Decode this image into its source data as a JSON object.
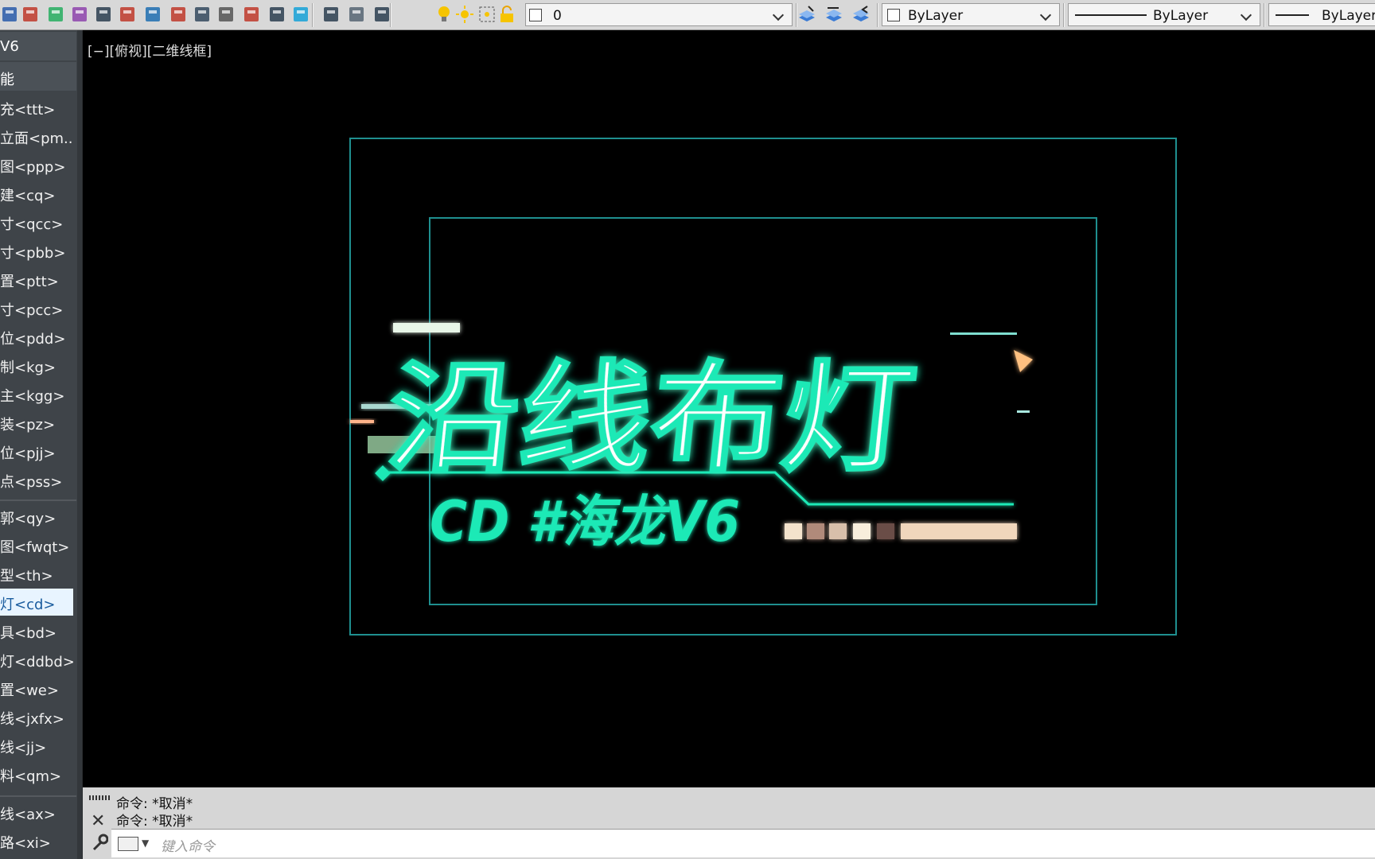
{
  "toolbar": {
    "icons": [
      "save-icon",
      "cut-icon",
      "layer-stack-icon",
      "search-replace-icon",
      "notebook-icon",
      "person-icon",
      "select-window-icon",
      "table-icon",
      "layer-tool-icon",
      "measure-icon",
      "delete-icon",
      "print-icon",
      "screen-icon",
      "lisp-edit-icon",
      "calc-icon",
      "layer-list-icon",
      "bulb-icon",
      "sun-icon",
      "freeze-icon",
      "lock-icon",
      "layer-icon-1",
      "layer-icon-2",
      "layer-icon-3"
    ],
    "layer_value": "0",
    "color_value": "ByLayer",
    "linetype_value": "ByLayer",
    "lineweight_value": "ByLayer"
  },
  "sidebar": {
    "header1": "V6",
    "header2": "能",
    "group1": [
      "充<ttt>",
      "立面<pm...",
      "图<ppp>",
      "建<cq>",
      "寸<qcc>",
      "寸<pbb>",
      "置<ptt>",
      "寸<pcc>",
      "位<pdd>",
      "制<kg>",
      "主<kgg>",
      "装<pz>",
      "位<pjj>",
      "点<pss>"
    ],
    "group2": [
      "郭<qy>",
      "图<fwqt>",
      "型<th>",
      "灯<cd>",
      "具<bd>",
      "灯<ddbd>",
      "置<we>",
      "线<jxfx>",
      "线<jj>",
      "料<qm>"
    ],
    "group3": [
      "线<ax>",
      "路<xi>"
    ],
    "active_index": 3
  },
  "viewport": {
    "label": "[−][俯视][二维线框]",
    "title_art": {
      "main": "沿线布灯",
      "sub": "CD #海龙V6",
      "glow_color": "#1de9b6",
      "frame_color": "#1f8f8f"
    }
  },
  "command": {
    "history": [
      "命令: *取消*",
      "命令: *取消*"
    ],
    "placeholder": "键入命令"
  }
}
